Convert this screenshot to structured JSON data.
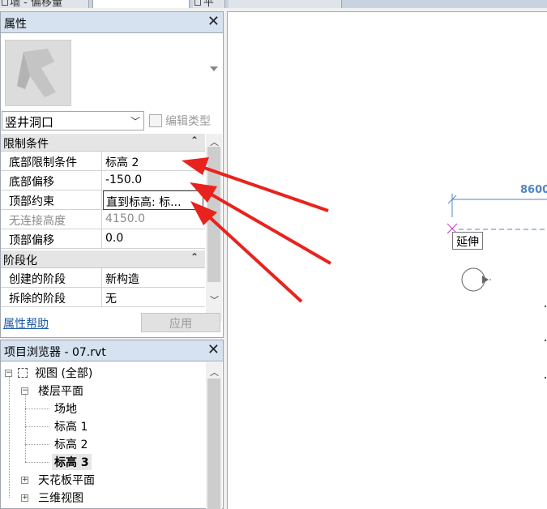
{
  "tabs": {
    "tab1_label": "墙 - 偏移量",
    "tab3_label": "平"
  },
  "properties": {
    "title": "属性",
    "type_selector": "竖井洞口",
    "edit_type": "编辑类型",
    "groups": [
      {
        "label": "限制条件",
        "rows": [
          {
            "key": "底部限制条件",
            "value": "标高 2"
          },
          {
            "key": "底部偏移",
            "value": "-150.0"
          },
          {
            "key": "顶部约束",
            "value": "直到标高: 标..."
          },
          {
            "key": "无连接高度",
            "value": "4150.0"
          },
          {
            "key": "顶部偏移",
            "value": "0.0"
          }
        ]
      },
      {
        "label": "阶段化",
        "rows": [
          {
            "key": "创建的阶段",
            "value": "新构造"
          },
          {
            "key": "拆除的阶段",
            "value": "无"
          }
        ]
      }
    ],
    "help_link": "属性帮助",
    "apply_button": "应用"
  },
  "browser": {
    "title": "项目浏览器 - 07.rvt",
    "tree": {
      "views_all": "视图 (全部)",
      "floor_plans": "楼层平面",
      "site": "场地",
      "level1": "标高 1",
      "level2": "标高 2",
      "level3": "标高 3",
      "ceiling_plans": "天花板平面",
      "views_3d": "三维视图"
    }
  },
  "canvas": {
    "dimension_label": "8600",
    "tooltip": "延伸"
  },
  "colors": {
    "panel_title_bg": "#d6e2ef",
    "annotation_arrow": "#e8231d",
    "dimension_blue": "#4f86c6",
    "link": "#1a5aa6"
  }
}
